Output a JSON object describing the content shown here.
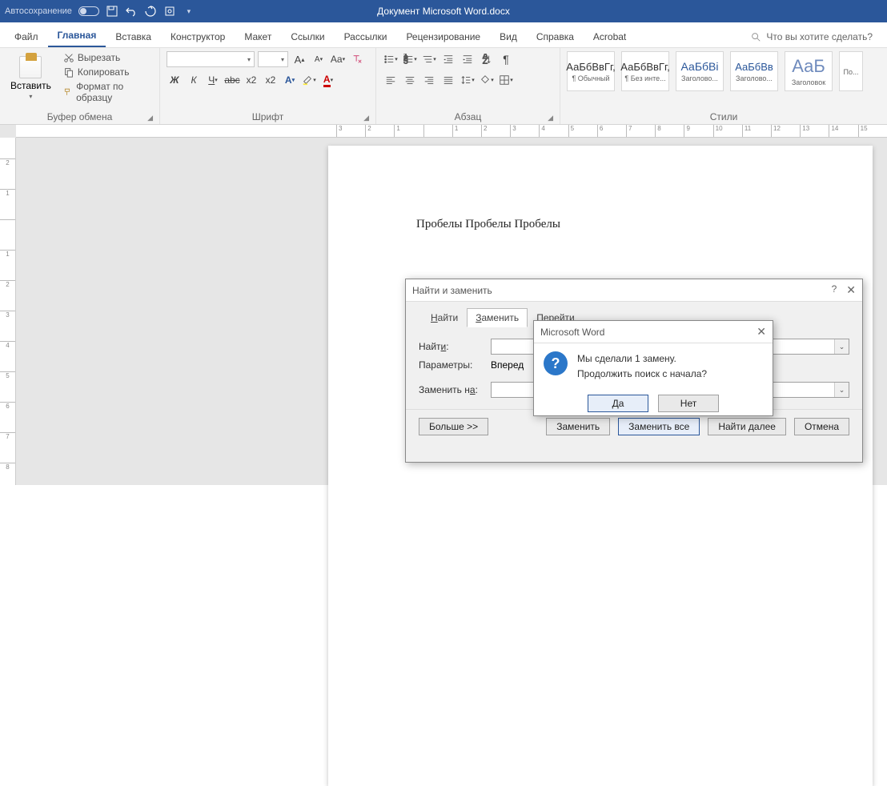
{
  "titlebar": {
    "autosave": "Автосохранение",
    "title": "Документ Microsoft Word.docx"
  },
  "menu": {
    "file": "Файл",
    "home": "Главная",
    "insert": "Вставка",
    "design": "Конструктор",
    "layout": "Макет",
    "refs": "Ссылки",
    "mail": "Рассылки",
    "review": "Рецензирование",
    "view": "Вид",
    "help": "Справка",
    "acrobat": "Acrobat",
    "search": "Что вы хотите сделать?"
  },
  "ribbon": {
    "clipboard": {
      "label": "Буфер обмена",
      "paste": "Вставить",
      "cut": "Вырезать",
      "copy": "Копировать",
      "format": "Формат по образцу"
    },
    "font": {
      "label": "Шрифт"
    },
    "paragraph": {
      "label": "Абзац"
    },
    "styles": {
      "label": "Стили",
      "tiles": [
        {
          "preview": "АаБбВвГг,",
          "name": "¶ Обычный"
        },
        {
          "preview": "АаБбВвГг,",
          "name": "¶ Без инте..."
        },
        {
          "preview": "АаБбВі",
          "name": "Заголово..."
        },
        {
          "preview": "АаБбВв",
          "name": "Заголово..."
        },
        {
          "preview": "АаБ",
          "name": "Заголовок"
        },
        {
          "preview": "",
          "name": "По..."
        }
      ]
    }
  },
  "document": {
    "text": "Пробелы Пробелы Пробелы"
  },
  "find_dialog": {
    "title": "Найти и заменить",
    "tabs": {
      "find": "айти",
      "replace": "аменить",
      "goto": "ерейти"
    },
    "find_label": "Найт",
    "find_u": "и",
    "find_colon": ":",
    "params_label": "Параметры:",
    "params_value": "Вперед",
    "replace_label": "Заменить н",
    "replace_u": "а",
    "replace_colon": ":",
    "more": "Больше >>",
    "replace": "Заменить",
    "replace_all": "Заменить все",
    "find_next": "Найти далее",
    "cancel": "Отмена"
  },
  "msg_dialog": {
    "title": "Microsoft Word",
    "line1": "Мы сделали 1 замену.",
    "line2": "Продолжить поиск с начала?",
    "yes": "Да",
    "no": "Нет"
  },
  "ruler": {
    "hticks": [
      "3",
      "2",
      "1",
      "",
      "1",
      "2",
      "3",
      "4",
      "5",
      "6",
      "7",
      "8",
      "9",
      "10",
      "11",
      "12",
      "13",
      "14",
      "15"
    ],
    "vticks": [
      "2",
      "1",
      "",
      "1",
      "2",
      "3",
      "4",
      "5",
      "6",
      "7",
      "8"
    ]
  }
}
